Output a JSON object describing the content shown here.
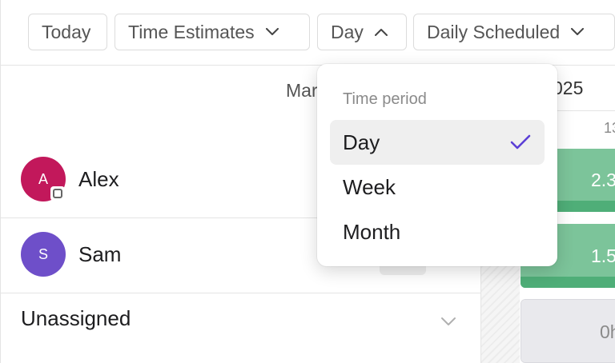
{
  "toolbar": {
    "today_label": "Today",
    "time_estimates_label": "Time Estimates",
    "period_label": "Day",
    "scheduled_label": "Daily Scheduled"
  },
  "calendar": {
    "month_label": "Mar",
    "year_label": "025",
    "day_number": "13"
  },
  "rows": [
    {
      "name": "Alex",
      "initial": "A",
      "avatar_color": "#c2185b",
      "bar_value": "2.3",
      "bar_color": "#7cc49a",
      "bar_foot_color": "#4fae78"
    },
    {
      "name": "Sam",
      "initial": "S",
      "avatar_color": "#6e4fc9",
      "bar_value": "1.5",
      "bar_color": "#7cc49a",
      "bar_foot_color": "#4fae78"
    },
    {
      "name": "Unassigned",
      "bar_value": "0h",
      "bar_color": "#e9e9ed"
    }
  ],
  "dropdown": {
    "header": "Time period",
    "items": [
      {
        "label": "Day",
        "selected": true
      },
      {
        "label": "Week",
        "selected": false
      },
      {
        "label": "Month",
        "selected": false
      }
    ],
    "check_color": "#5b3fd6"
  },
  "icons": {
    "chevron_down": "chevron-down-icon",
    "chevron_up": "chevron-up-icon",
    "check": "check-icon"
  }
}
